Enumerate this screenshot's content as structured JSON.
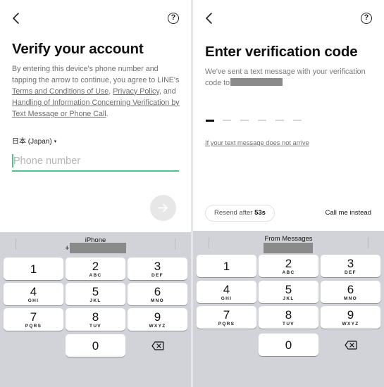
{
  "left": {
    "title": "Verify your account",
    "terms_intro": "By entering this device's phone number and tapping the arrow to continue, you agree to LINE's",
    "link_terms": "Terms and Conditions of Use",
    "sep_comma": ",",
    "link_privacy": "Privacy Policy",
    "and_text": ", and",
    "link_handling": "Handling of Information Concerning Verification by Text Message or Phone Call",
    "period": ".",
    "country": "日本 (Japan)",
    "country_caret": "▾",
    "phone_placeholder": "Phone number",
    "suggestion_label": "iPhone",
    "suggestion_plus": "+",
    "help": "?"
  },
  "right": {
    "title": "Enter verification code",
    "subtitle": "We've sent a text message with your verification code to",
    "no_arrive": "If your text message does not arrive",
    "resend_label": "Resend after",
    "resend_time": "53s",
    "call_me": "Call me instead",
    "suggestion_label": "From Messages",
    "help": "?"
  },
  "keypad": [
    {
      "num": "1",
      "letters": ""
    },
    {
      "num": "2",
      "letters": "ABC"
    },
    {
      "num": "3",
      "letters": "DEF"
    },
    {
      "num": "4",
      "letters": "GHI"
    },
    {
      "num": "5",
      "letters": "JKL"
    },
    {
      "num": "6",
      "letters": "MNO"
    },
    {
      "num": "7",
      "letters": "PQRS"
    },
    {
      "num": "8",
      "letters": "TUV"
    },
    {
      "num": "9",
      "letters": "WXYZ"
    },
    {
      "num": "0",
      "letters": ""
    }
  ],
  "icons": {
    "back": "chevron-left-icon",
    "help": "help-circle-icon",
    "next": "arrow-right-icon",
    "backspace": "backspace-icon"
  },
  "colors": {
    "accent": "#4fc38a",
    "keyboard_bg": "#d1d3d9",
    "redaction": "#8a8a8a"
  }
}
